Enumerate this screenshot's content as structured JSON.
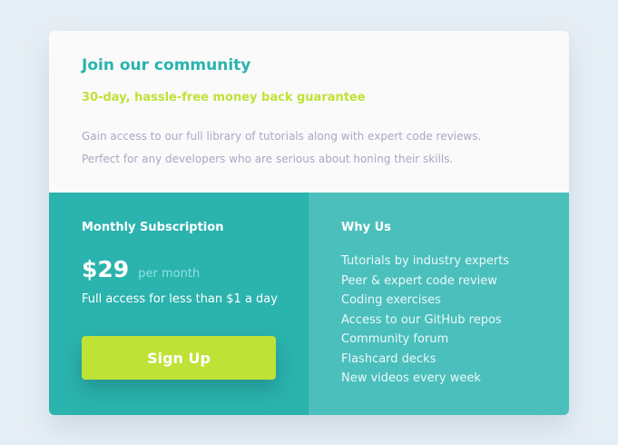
{
  "header": {
    "title": "Join our community",
    "guarantee": "30-day, hassle-free money back guarantee",
    "description_line1": "Gain access to our full library of tutorials along with expert code reviews.",
    "description_line2": "Perfect for any developers who are serious about honing their skills."
  },
  "subscription": {
    "title": "Monthly Subscription",
    "price": "$29",
    "period": "per month",
    "note": "Full access for less than $1 a day",
    "button_label": "Sign Up"
  },
  "why_us": {
    "title": "Why Us",
    "items": [
      "Tutorials by industry experts",
      "Peer & expert code review",
      "Coding exercises",
      "Access to our GitHub repos",
      "Community forum",
      "Flashcard decks",
      "New videos every week"
    ]
  },
  "colors": {
    "background": "#e6eef5",
    "accent_teal": "#2bb3ae",
    "secondary_teal": "#4bbfbc",
    "accent_green": "#bfe236",
    "muted_text": "#a8a9c2"
  }
}
